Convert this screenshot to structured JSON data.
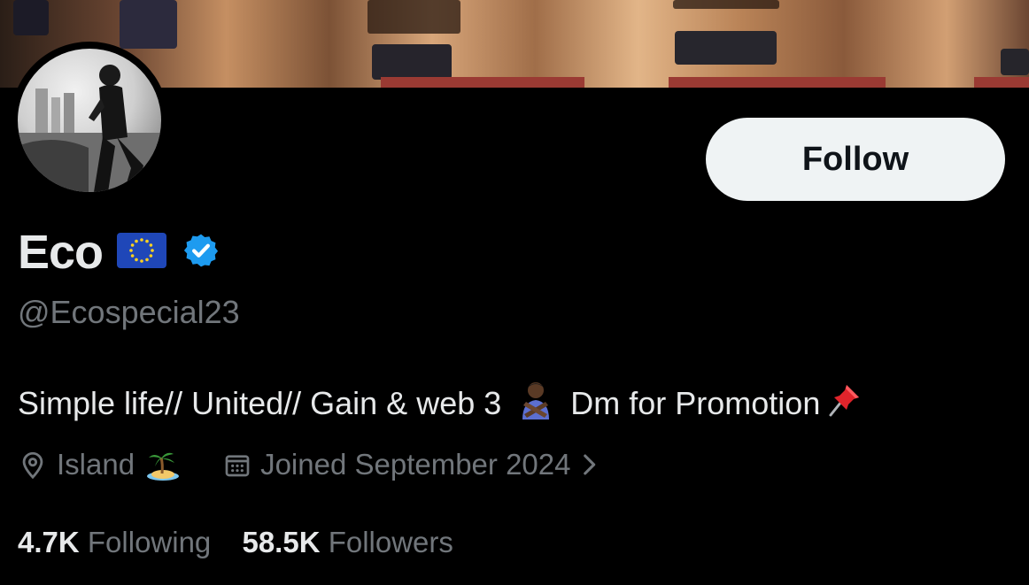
{
  "profile": {
    "name": "Eco",
    "handle": "@Ecospecial23",
    "bio": {
      "part1": "Simple life// United// Gain & web 3",
      "part2": "Dm for Promotion"
    },
    "location": "Island",
    "joined": "Joined September 2024",
    "following_count": "4.7K",
    "following_label": "Following",
    "followers_count": "58.5K",
    "followers_label": "Followers"
  },
  "actions": {
    "follow_label": "Follow"
  },
  "icons": {
    "flag": "eu-flag-icon",
    "verified": "verified-badge-icon",
    "location": "location-pin-icon",
    "calendar": "calendar-icon",
    "chevron": "chevron-right-icon",
    "bio_emoji_1": "person-gesturing-no-icon",
    "bio_emoji_2": "pushpin-icon",
    "location_emoji": "desert-island-icon"
  },
  "colors": {
    "background": "#000000",
    "text_primary": "#e7e9ea",
    "text_secondary": "#71767b",
    "verified_blue": "#1d9bf0",
    "button_bg": "#eff3f4"
  }
}
